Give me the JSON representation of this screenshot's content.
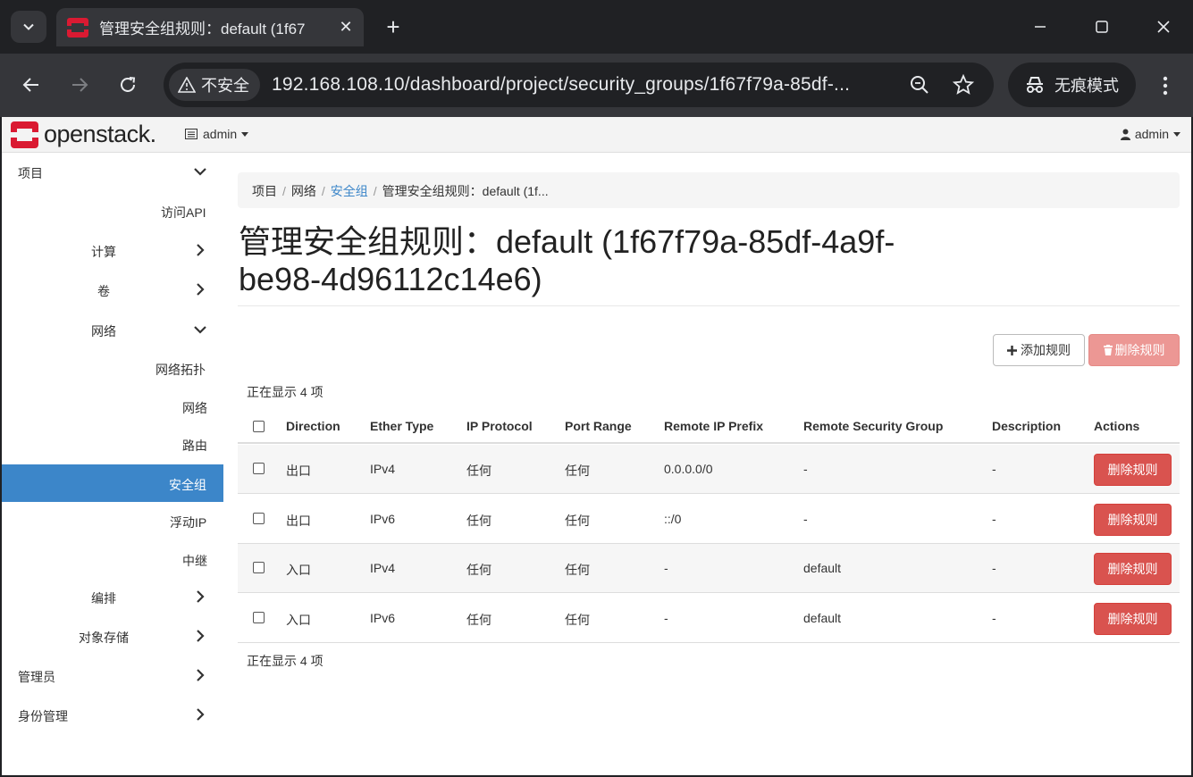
{
  "browser": {
    "tab_title": "管理安全组规则：default (1f67",
    "security_label": "不安全",
    "url": "192.168.108.10/dashboard/project/security_groups/1f67f79a-85df-...",
    "incognito_label": "无痕模式"
  },
  "topnav": {
    "logo_text": "openstack.",
    "project_switcher": "admin",
    "user_menu": "admin"
  },
  "sidebar": {
    "items": [
      {
        "label": "项目"
      },
      {
        "label": "访问API"
      },
      {
        "label": "计算"
      },
      {
        "label": "卷"
      },
      {
        "label": "网络"
      },
      {
        "label": "网络拓扑"
      },
      {
        "label": "网络"
      },
      {
        "label": "路由"
      },
      {
        "label": "安全组"
      },
      {
        "label": "浮动IP"
      },
      {
        "label": "中继"
      },
      {
        "label": "编排"
      },
      {
        "label": "对象存储"
      },
      {
        "label": "管理员"
      },
      {
        "label": "身份管理"
      }
    ]
  },
  "breadcrumb": {
    "items": [
      "项目",
      "网络",
      "安全组",
      "管理安全组规则：default (1f..."
    ]
  },
  "page": {
    "title_line1": "管理安全组规则：default (1f67f79a-85df-4a9f-",
    "title_line2": "be98-4d96112c14e6)",
    "add_rule_label": "添加规则",
    "delete_rules_label": "删除规则",
    "count_text": "正在显示 4 项"
  },
  "table": {
    "columns": [
      "Direction",
      "Ether Type",
      "IP Protocol",
      "Port Range",
      "Remote IP Prefix",
      "Remote Security Group",
      "Description",
      "Actions"
    ],
    "rows": [
      {
        "direction": "出口",
        "ether_type": "IPv4",
        "ip_protocol": "任何",
        "port_range": "任何",
        "remote_ip_prefix": "0.0.0.0/0",
        "remote_security_group": "-",
        "description": "-",
        "action": "删除规则"
      },
      {
        "direction": "出口",
        "ether_type": "IPv6",
        "ip_protocol": "任何",
        "port_range": "任何",
        "remote_ip_prefix": "::/0",
        "remote_security_group": "-",
        "description": "-",
        "action": "删除规则"
      },
      {
        "direction": "入口",
        "ether_type": "IPv4",
        "ip_protocol": "任何",
        "port_range": "任何",
        "remote_ip_prefix": "-",
        "remote_security_group": "default",
        "description": "-",
        "action": "删除规则"
      },
      {
        "direction": "入口",
        "ether_type": "IPv6",
        "ip_protocol": "任何",
        "port_range": "任何",
        "remote_ip_prefix": "-",
        "remote_security_group": "default",
        "description": "-",
        "action": "删除规则"
      }
    ]
  },
  "colors": {
    "accent": "#3c86c9",
    "danger": "#d9534f",
    "danger_disabled": "#ec9794",
    "brand_red": "#da1a32"
  }
}
